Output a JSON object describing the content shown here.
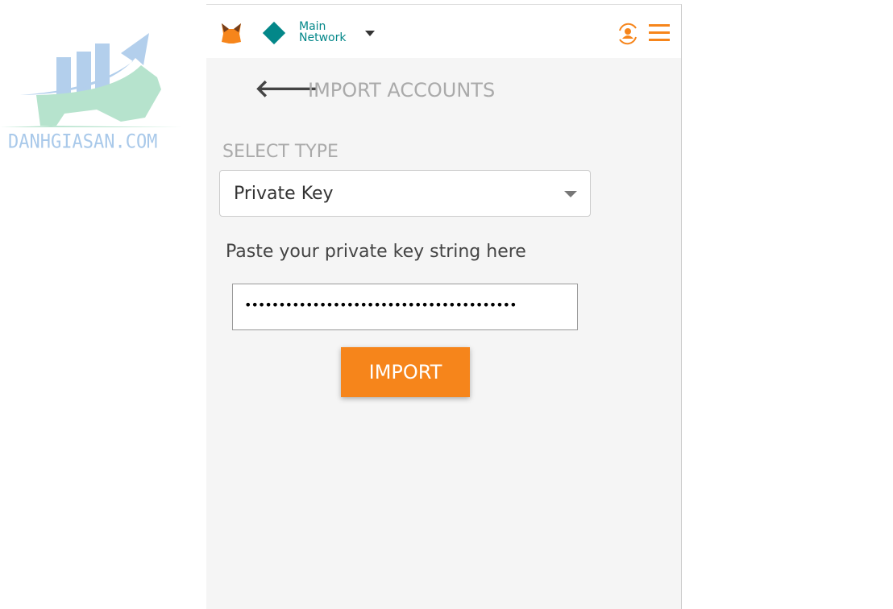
{
  "watermark": {
    "text": "DANHGIASAN.COM"
  },
  "header": {
    "network_line1": "Main",
    "network_line2": "Network",
    "accent": "#f6851b",
    "network_color": "#038789"
  },
  "page": {
    "title": "IMPORT ACCOUNTS",
    "select_type_label": "SELECT TYPE",
    "selected_type": "Private Key",
    "hint": "Paste your private key string here",
    "key_value": "••••••••••••••••••••••••••••••••••••••••",
    "import_label": "IMPORT"
  }
}
